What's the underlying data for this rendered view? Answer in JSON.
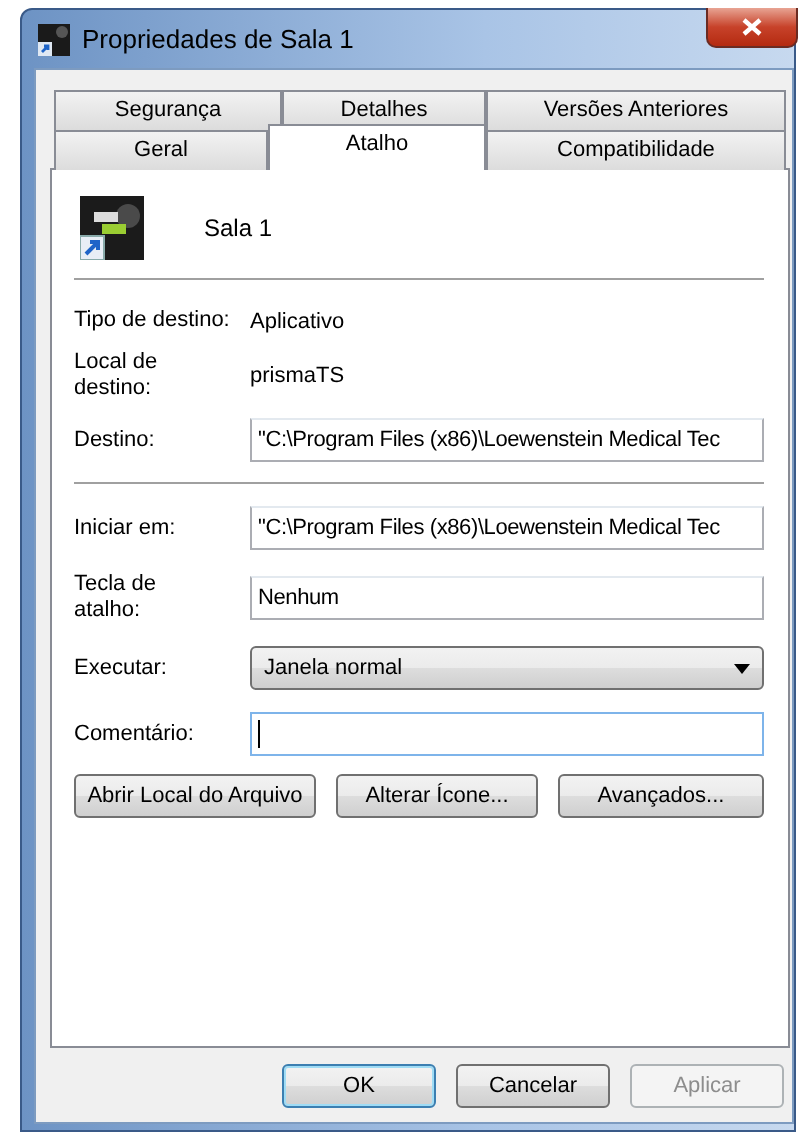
{
  "window": {
    "title": "Propriedades de Sala 1"
  },
  "tab_rows": [
    {
      "tabs": [
        {
          "label": "Segurança",
          "selected": false
        },
        {
          "label": "Detalhes",
          "selected": false
        },
        {
          "label": "Versões Anteriores",
          "selected": false
        }
      ]
    },
    {
      "tabs": [
        {
          "label": "Geral",
          "selected": false
        },
        {
          "label": "Atalho",
          "selected": true
        },
        {
          "label": "Compatibilidade",
          "selected": false
        }
      ]
    }
  ],
  "shortcut": {
    "name": "Sala 1"
  },
  "sections": [
    {
      "rows": [
        {
          "kind": "info",
          "label": "Tipo de destino:",
          "value": "Aplicativo"
        },
        {
          "kind": "info",
          "label": "Local de destino:",
          "value": "prismaTS"
        },
        {
          "kind": "input",
          "label": "Destino:",
          "value": "\"C:\\Program Files (x86)\\Loewenstein Medical Tec",
          "focused": false
        }
      ]
    },
    {
      "rows": [
        {
          "kind": "input",
          "label": "Iniciar em:",
          "value": "\"C:\\Program Files (x86)\\Loewenstein Medical Tec",
          "focused": false
        },
        {
          "kind": "input",
          "label": "Tecla de atalho:",
          "value": "Nenhum",
          "focused": false
        },
        {
          "kind": "dropdown",
          "label": "Executar:",
          "value": "Janela normal"
        },
        {
          "kind": "input",
          "label": "Comentário:",
          "value": "",
          "focused": true
        }
      ]
    }
  ],
  "action_buttons": [
    "Abrir Local do Arquivo",
    "Alterar Ícone...",
    "Avançados..."
  ],
  "dialog_buttons": [
    {
      "label": "OK",
      "default": true,
      "disabled": false
    },
    {
      "label": "Cancelar",
      "default": false,
      "disabled": false
    },
    {
      "label": "Aplicar",
      "default": false,
      "disabled": true
    }
  ]
}
